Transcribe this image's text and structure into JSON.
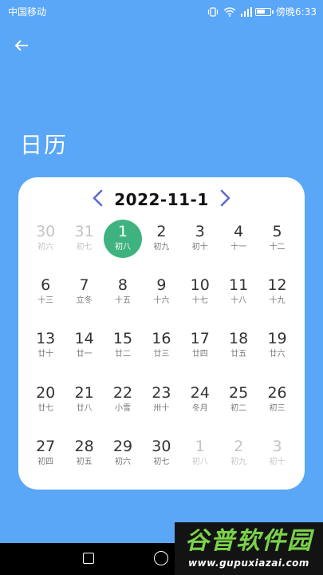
{
  "status_bar": {
    "carrier": "中国移动",
    "time": "傍晚6:33"
  },
  "header": {
    "back_icon": "arrow-left-icon",
    "title": "日历"
  },
  "calendar": {
    "month_label": "2022-11-1",
    "prev_icon": "chevron-left-icon",
    "next_icon": "chevron-right-icon",
    "accent_color": "#3fb37f",
    "nav_color": "#5b6bd6",
    "days": [
      {
        "num": "30",
        "lunar": "初六",
        "dim": true
      },
      {
        "num": "31",
        "lunar": "初七",
        "dim": true
      },
      {
        "num": "1",
        "lunar": "初八",
        "selected": true
      },
      {
        "num": "2",
        "lunar": "初九"
      },
      {
        "num": "3",
        "lunar": "初十"
      },
      {
        "num": "4",
        "lunar": "十一"
      },
      {
        "num": "5",
        "lunar": "十二"
      },
      {
        "num": "6",
        "lunar": "十三"
      },
      {
        "num": "7",
        "lunar": "立冬"
      },
      {
        "num": "8",
        "lunar": "十五"
      },
      {
        "num": "9",
        "lunar": "十六"
      },
      {
        "num": "10",
        "lunar": "十七"
      },
      {
        "num": "11",
        "lunar": "十八"
      },
      {
        "num": "12",
        "lunar": "十九"
      },
      {
        "num": "13",
        "lunar": "廿十"
      },
      {
        "num": "14",
        "lunar": "廿一"
      },
      {
        "num": "15",
        "lunar": "廿二"
      },
      {
        "num": "16",
        "lunar": "廿三"
      },
      {
        "num": "17",
        "lunar": "廿四"
      },
      {
        "num": "18",
        "lunar": "廿五"
      },
      {
        "num": "19",
        "lunar": "廿六"
      },
      {
        "num": "20",
        "lunar": "廿七"
      },
      {
        "num": "21",
        "lunar": "廿八"
      },
      {
        "num": "22",
        "lunar": "小雪"
      },
      {
        "num": "23",
        "lunar": "卅十"
      },
      {
        "num": "24",
        "lunar": "冬月"
      },
      {
        "num": "25",
        "lunar": "初二"
      },
      {
        "num": "26",
        "lunar": "初三"
      },
      {
        "num": "27",
        "lunar": "初四"
      },
      {
        "num": "28",
        "lunar": "初五"
      },
      {
        "num": "29",
        "lunar": "初六"
      },
      {
        "num": "30",
        "lunar": "初七"
      },
      {
        "num": "1",
        "lunar": "初八",
        "dim": true
      },
      {
        "num": "2",
        "lunar": "初九",
        "dim": true
      },
      {
        "num": "3",
        "lunar": "初十",
        "dim": true
      }
    ]
  },
  "watermark": {
    "brand": "谷普软件园",
    "url": "www.gupuxiazai.com"
  }
}
